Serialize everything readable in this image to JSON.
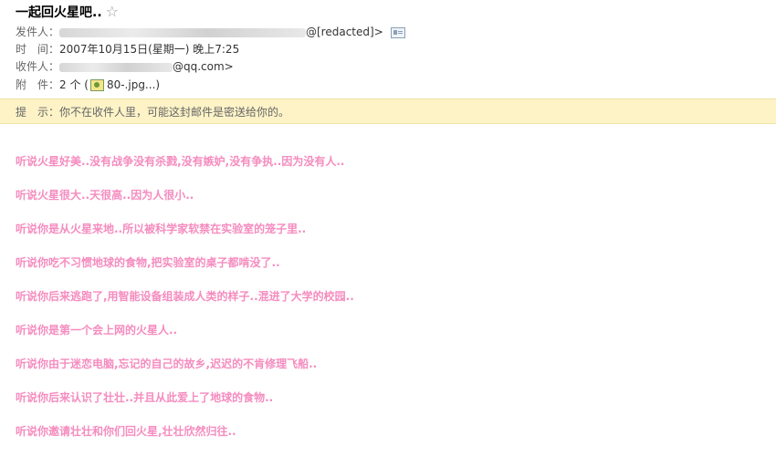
{
  "email": {
    "subject": "一起回火星吧..",
    "star_glyph": "☆",
    "from_label": "发件人：",
    "from_suffix": "@[redacted]>",
    "time_label": "时　间：",
    "time_value": "2007年10月15日(星期一) 晚上7:25",
    "to_label": "收件人：",
    "to_suffix": "@qq.com>",
    "attachment_label": "附　件：",
    "attachment_count": "2 个 (",
    "attachment_name": "80-.jpg...)",
    "icons": {
      "star": "star-icon",
      "contact_card": "contact-card-icon",
      "image": "image-file-icon"
    }
  },
  "notice": {
    "label": "提　示：",
    "text": "你不在收件人里，可能这封邮件是密送给你的。"
  },
  "body": {
    "color": "#f58cbf",
    "lines": [
      "听说火星好美..没有战争没有杀戮,没有嫉妒,没有争执..因为没有人..",
      "听说火星很大..天很高..因为人很小..",
      "听说你是从火星来地..所以被科学家软禁在实验室的笼子里..",
      "听说你吃不习惯地球的食物,把实验室的桌子都啃没了..",
      "听说你后来逃跑了,用智能设备组装成人类的样子..混进了大学的校园..",
      "听说你是第一个会上网的火星人..",
      "听说你由于迷恋电脑,忘记的自己的故乡,迟迟的不肯修理飞船..",
      "听说你后来认识了壮壮..并且从此爱上了地球的食物..",
      "听说你邀请壮壮和你们回火星,壮壮欣然归往.."
    ]
  }
}
